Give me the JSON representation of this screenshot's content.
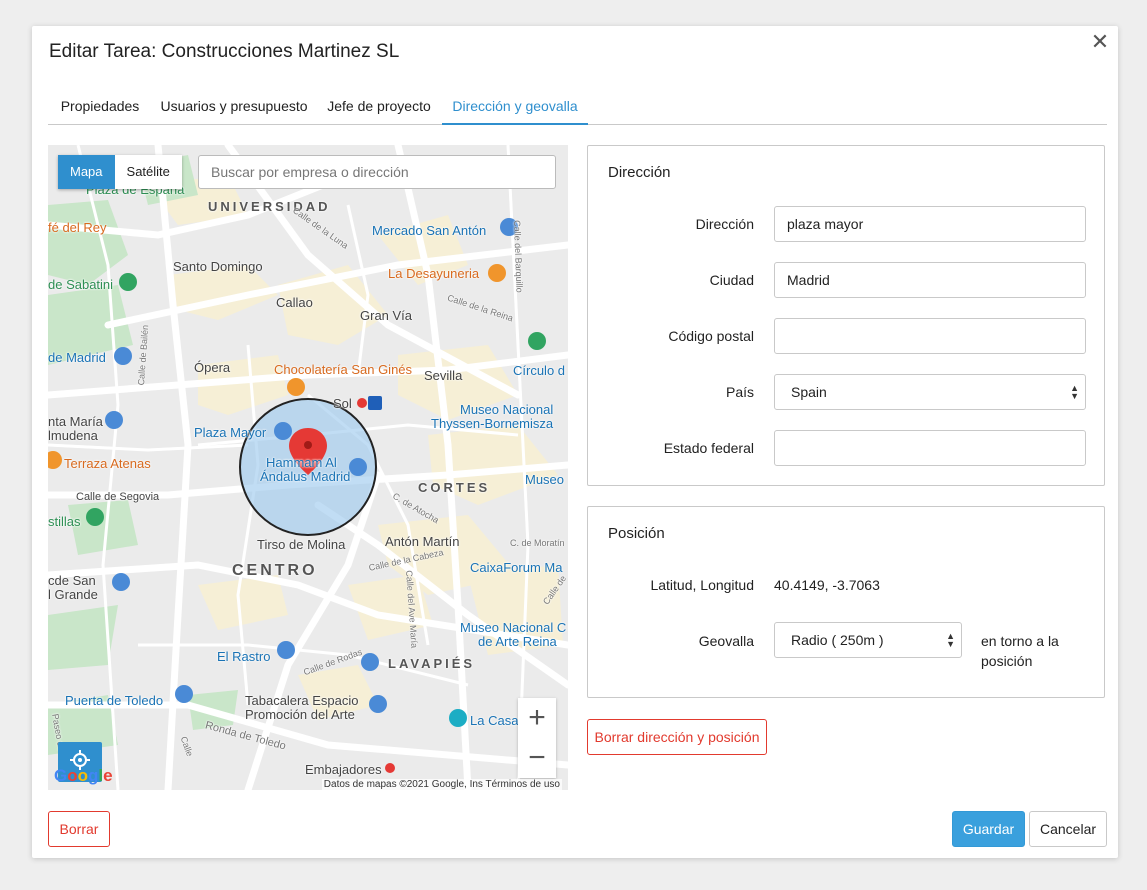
{
  "dialog": {
    "title": "Editar Tarea: Construcciones Martinez SL",
    "close_icon": "close-icon"
  },
  "tabs": [
    {
      "label": "Propiedades",
      "active": false
    },
    {
      "label": "Usuarios y presupuesto",
      "active": false
    },
    {
      "label": "Jefe de proyecto",
      "active": false
    },
    {
      "label": "Dirección y geovalla",
      "active": true
    }
  ],
  "map": {
    "type_buttons": {
      "map": "Mapa",
      "satellite": "Satélite",
      "selected": "Mapa"
    },
    "search_placeholder": "Buscar por empresa o dirección",
    "labels": {
      "universidad": "UNIVERSIDAD",
      "cortes": "CORTES",
      "centro": "CENTRO",
      "lavapies": "LAVAPIÉS",
      "mercado_san_anton": "Mercado San Antón",
      "la_desayuneria": "La Desayuneria",
      "santo_domingo": "Santo Domingo",
      "callao": "Callao",
      "gran_via": "Gran Vía",
      "sabatini": "de Sabatini",
      "de_madrid": "de Madrid",
      "opera": "Ópera",
      "chocolateria": "Chocolatería San Ginés",
      "sevilla": "Sevilla",
      "circulo": "Círculo d",
      "sol": "Sol",
      "museo_thyssen_1": "Museo Nacional",
      "museo_thyssen_2": "Thyssen-Bornemisza",
      "santa_maria_1": "nta María",
      "santa_maria_2": "lmudena",
      "plaza_mayor": "Plaza Mayor",
      "hammam_1": "Hammam Al",
      "hammam_2": "Ándalus Madrid",
      "terraza": "Terraza Atenas",
      "museo": "Museo",
      "calle_segovia": "Calle de Segovia",
      "stillas": "stillas",
      "tirso": "Tirso de Molina",
      "anton_martin": "Antón Martín",
      "caixaforum": "CaixaForum Ma",
      "san_fran_1": "cde San",
      "san_fran_2": "l Grande",
      "museo_reina_1": "Museo Nacional C",
      "museo_reina_2": "de Arte Reina",
      "el_rastro": "El Rastro",
      "puerta_toledo": "Puerta de Toledo",
      "tabacalera_1": "Tabacalera Espacio",
      "tabacalera_2": "Promoción del Arte",
      "la_casa": "La Casa",
      "embajadores": "Embajadores",
      "plaza_espana": "Plaza de España",
      "cafe_rey": "fé del Rey",
      "calle_bailen": "Calle de Bailén",
      "calle_luna": "Calle de la Luna",
      "calle_reina": "Calle de la Reina",
      "calle_barquillo": "Calle del Barquillo",
      "calle_atocha": "C. de Atocha",
      "calle_cabeza": "Calle de la Cabeza",
      "calle_ave_maria": "Calle del Ave María",
      "calle_moratin": "C. de Moratín",
      "calle_toledo": "Ronda de Toledo",
      "calle_rodas": "Calle de Rodas",
      "calle_paseo": "Paseo de",
      "calle_oriente": "Calle",
      "calle_argumosa": "Calle de"
    },
    "geofence_radius_m": 250,
    "zoom_in": "+",
    "zoom_out": "−",
    "attribution": "Datos de mapas ©2021 Google, Ins  Términos de uso",
    "logo_text": "Google"
  },
  "address_panel": {
    "title": "Dirección",
    "fields": {
      "direccion": {
        "label": "Dirección",
        "value": "plaza mayor"
      },
      "ciudad": {
        "label": "Ciudad",
        "value": "Madrid"
      },
      "codigo_postal": {
        "label": "Código postal",
        "value": ""
      },
      "pais": {
        "label": "País",
        "value": "Spain"
      },
      "estado": {
        "label": "Estado federal",
        "value": ""
      }
    }
  },
  "position_panel": {
    "title": "Posición",
    "latlng_label": "Latitud, Longitud",
    "latlng_value": "40.4149, -3.7063",
    "geofence_label": "Geovalla",
    "geofence_value": "Radio ( 250m )",
    "geofence_suffix": "en torno a la posición"
  },
  "buttons": {
    "clear_address": "Borrar dirección y posición",
    "delete": "Borrar",
    "save": "Guardar",
    "cancel": "Cancelar"
  },
  "colors": {
    "accent": "#2f8fce",
    "danger": "#e23a2e",
    "primary_button": "#3aa0dd",
    "marker": "#e53935",
    "geofence_fill": "#a9cff0"
  }
}
